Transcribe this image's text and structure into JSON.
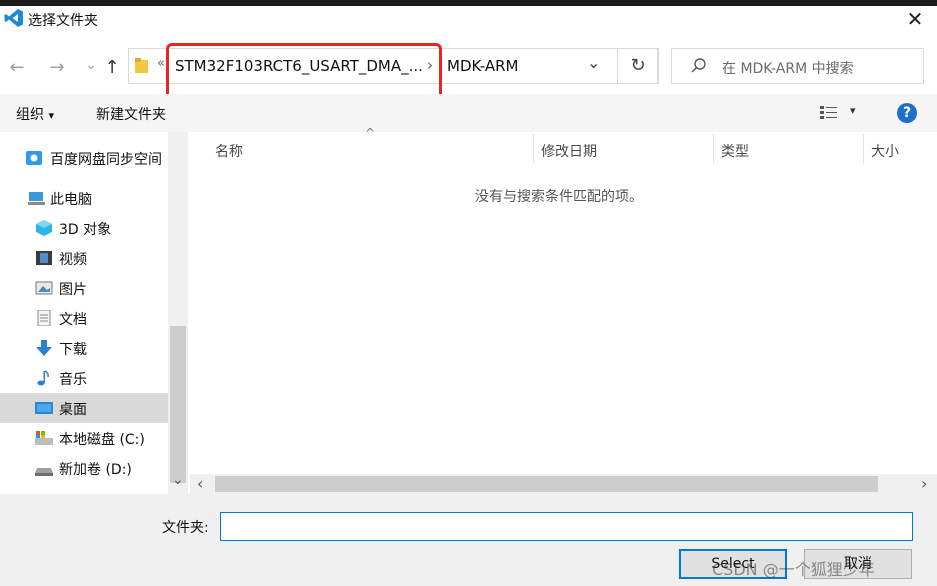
{
  "window": {
    "title": "选择文件夹",
    "close_glyph": "✕"
  },
  "nav": {
    "back_glyph": "←",
    "forward_glyph": "→",
    "recent_glyph": "⌄",
    "up_glyph": "↑",
    "overflow_glyph": "«",
    "breadcrumb": [
      {
        "label": "STM32F103RCT6_USART_DMA_..."
      },
      {
        "label": "MDK-ARM"
      }
    ],
    "sep_glyph": "›",
    "dropdown_glyph": "⌄",
    "refresh_glyph": "↻",
    "search_placeholder": "在 MDK-ARM 中搜索"
  },
  "toolbar": {
    "organize_label": "组织",
    "organize_arrow": "▾",
    "new_folder_label": "新建文件夹",
    "view_arrow": "▾",
    "help_label": "?"
  },
  "sidebar": {
    "items": [
      {
        "label": "百度网盘同步空间",
        "icon": "baidu-sync-icon"
      },
      {
        "label": "此电脑",
        "icon": "computer-icon"
      },
      {
        "label": "3D 对象",
        "icon": "3d-objects-icon"
      },
      {
        "label": "视频",
        "icon": "video-icon"
      },
      {
        "label": "图片",
        "icon": "pictures-icon"
      },
      {
        "label": "文档",
        "icon": "documents-icon"
      },
      {
        "label": "下载",
        "icon": "download-icon"
      },
      {
        "label": "音乐",
        "icon": "music-icon"
      },
      {
        "label": "桌面",
        "icon": "desktop-icon",
        "selected": true
      },
      {
        "label": "本地磁盘 (C:)",
        "icon": "local-disk-icon"
      },
      {
        "label": "新加卷 (D:)",
        "icon": "drive-icon"
      }
    ],
    "scroll_down_glyph": "⌄"
  },
  "filelist": {
    "columns": [
      "名称",
      "修改日期",
      "类型",
      "大小"
    ],
    "sort_glyph": "^",
    "empty_message": "没有与搜索条件匹配的项。",
    "scroll_left_glyph": "‹",
    "scroll_right_glyph": "›"
  },
  "footer": {
    "folder_label": "文件夹:",
    "folder_value": "",
    "select_label": "Select",
    "cancel_label": "取消"
  },
  "watermark": "CSDN @一个狐狸少年",
  "colors": {
    "accent": "#0078d7",
    "highlight": "#e8261f",
    "selected_bg": "#d9d9d9"
  }
}
